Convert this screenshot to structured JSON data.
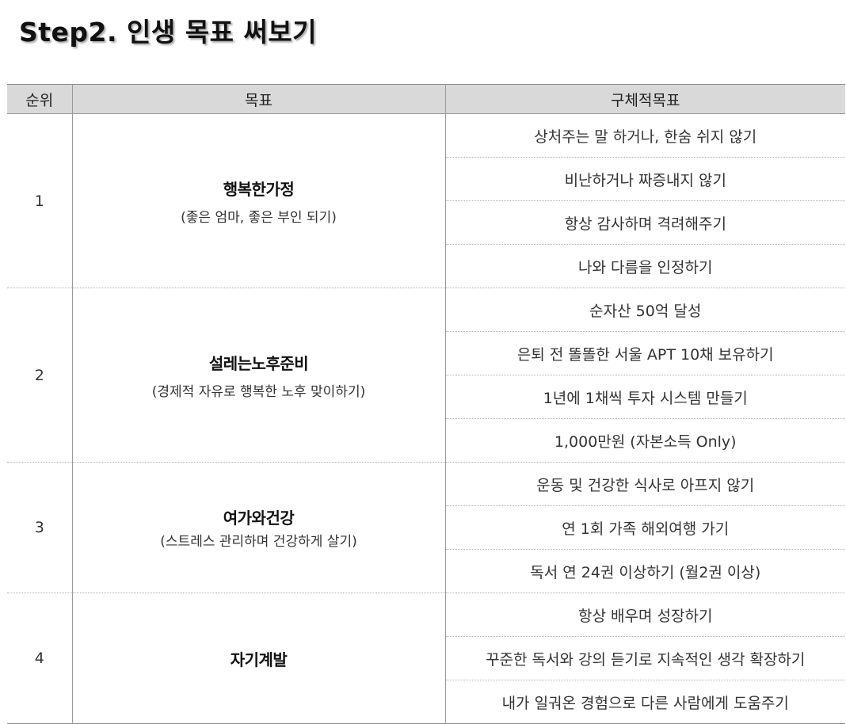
{
  "title": "Step2. 인생 목표 써보기",
  "table": {
    "headers": {
      "rank": "순위",
      "goal": "목표",
      "detail": "구체적목표"
    },
    "groups": [
      {
        "rank": "1",
        "goal": "행복한가정",
        "goal_note": "(좋은 엄마, 좋은 부인 되기)",
        "details": [
          "상처주는 말 하거나, 한숨 쉬지 않기",
          "비난하거나 짜증내지 않기",
          "항상 감사하며 격려해주기",
          "나와 다름을 인정하기"
        ]
      },
      {
        "rank": "2",
        "goal": "설레는노후준비",
        "goal_note": "(경제적 자유로 행복한 노후 맞이하기)",
        "details": [
          "순자산 50억 달성",
          "은퇴 전 똘똘한 서울 APT 10채 보유하기",
          "1년에 1채씩 투자 시스템 만들기",
          "1,000만원 (자본소득 Only)"
        ]
      },
      {
        "rank": "3",
        "goal": "여가와건강",
        "goal_note": "(스트레스 관리하며 건강하게 살기)",
        "details": [
          "운동 및 건강한 식사로 아프지 않기",
          "연 1회 가족 해외여행 가기",
          "독서 연 24권 이상하기 (월2권 이상)"
        ]
      },
      {
        "rank": "4",
        "goal": "자기계발",
        "goal_note": "",
        "details": [
          "항상 배우며 성장하기",
          "꾸준한 독서와 강의 듣기로 지속적인 생각 확장하기",
          "내가 일궈온 경험으로 다른 사람에게 도움주기"
        ]
      }
    ]
  }
}
